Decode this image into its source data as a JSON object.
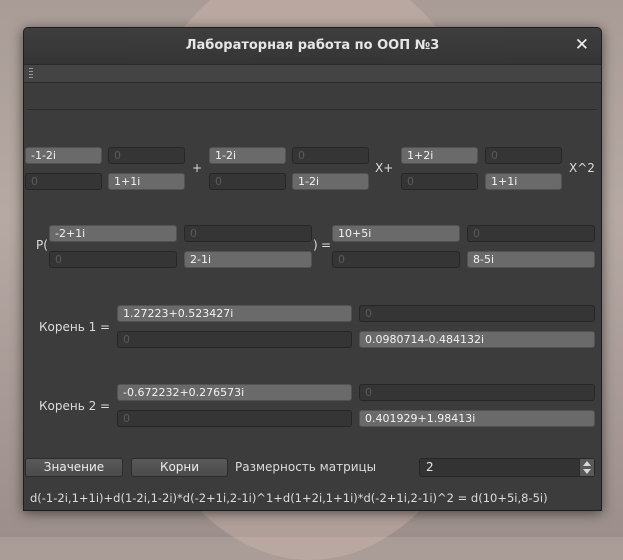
{
  "window": {
    "title": "Лабораторная работа по ООП №3",
    "close_icon": "close-icon"
  },
  "matrices": {
    "a0": [
      "-1-2i",
      "0",
      "0",
      "1+1i"
    ],
    "a1": [
      "1-2i",
      "0",
      "0",
      "1-2i"
    ],
    "a2": [
      "1+2i",
      "0",
      "0",
      "1+1i"
    ],
    "plus": "+",
    "x": "X+",
    "x2": "X^2",
    "p_open": "P(",
    "p_close": ")",
    "eq": "=",
    "p_arg": [
      "-2+1i",
      "0",
      "0",
      "2-1i"
    ],
    "p_res": [
      "10+5i",
      "0",
      "0",
      "8-5i"
    ]
  },
  "roots": {
    "r1_label": "Корень 1 =",
    "r1": [
      "1.27223+0.523427i",
      "0",
      "0",
      "0.0980714-0.484132i"
    ],
    "r2_label": "Корень 2 =",
    "r2": [
      "-0.672232+0.276573i",
      "0",
      "0",
      "0.401929+1.98413i"
    ]
  },
  "controls": {
    "value_button": "Значение",
    "roots_button": "Корни",
    "dim_label": "Размерность матрицы",
    "dim_value": "2"
  },
  "formula": "d(-1-2i,1+1i)+d(1-2i,1-2i)*d(-2+1i,2-1i)^1+d(1+2i,1+1i)*d(-2+1i,2-1i)^2  = d(10+5i,8-5i)"
}
